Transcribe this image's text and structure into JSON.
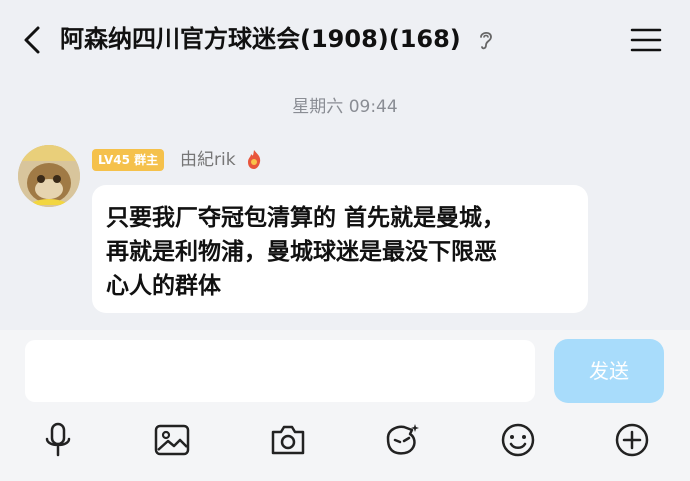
{
  "header": {
    "title": "阿森纳四川官方球迷会(1908)(168)",
    "back_icon": "chevron-left-icon",
    "ear_icon": "ear-icon",
    "menu_icon": "hamburger-menu-icon"
  },
  "timestamp": "星期六 09:44",
  "message": {
    "badge": "LV45 群主",
    "sender": "由紀rik",
    "text_lines": [
      "只要我厂夺冠包清算的 首先就是曼城，",
      "再就是利物浦，曼城球迷是最没下限恶",
      "心人的群体"
    ]
  },
  "composer": {
    "input_value": "",
    "send_label": "发送"
  },
  "toolbar": {
    "icons": [
      "microphone-icon",
      "image-icon",
      "camera-icon",
      "sticker-icon",
      "emoji-icon",
      "plus-icon"
    ]
  },
  "colors": {
    "background": "#eef0f4",
    "badge": "#f5c14b",
    "send_button": "#a8dcfb"
  }
}
